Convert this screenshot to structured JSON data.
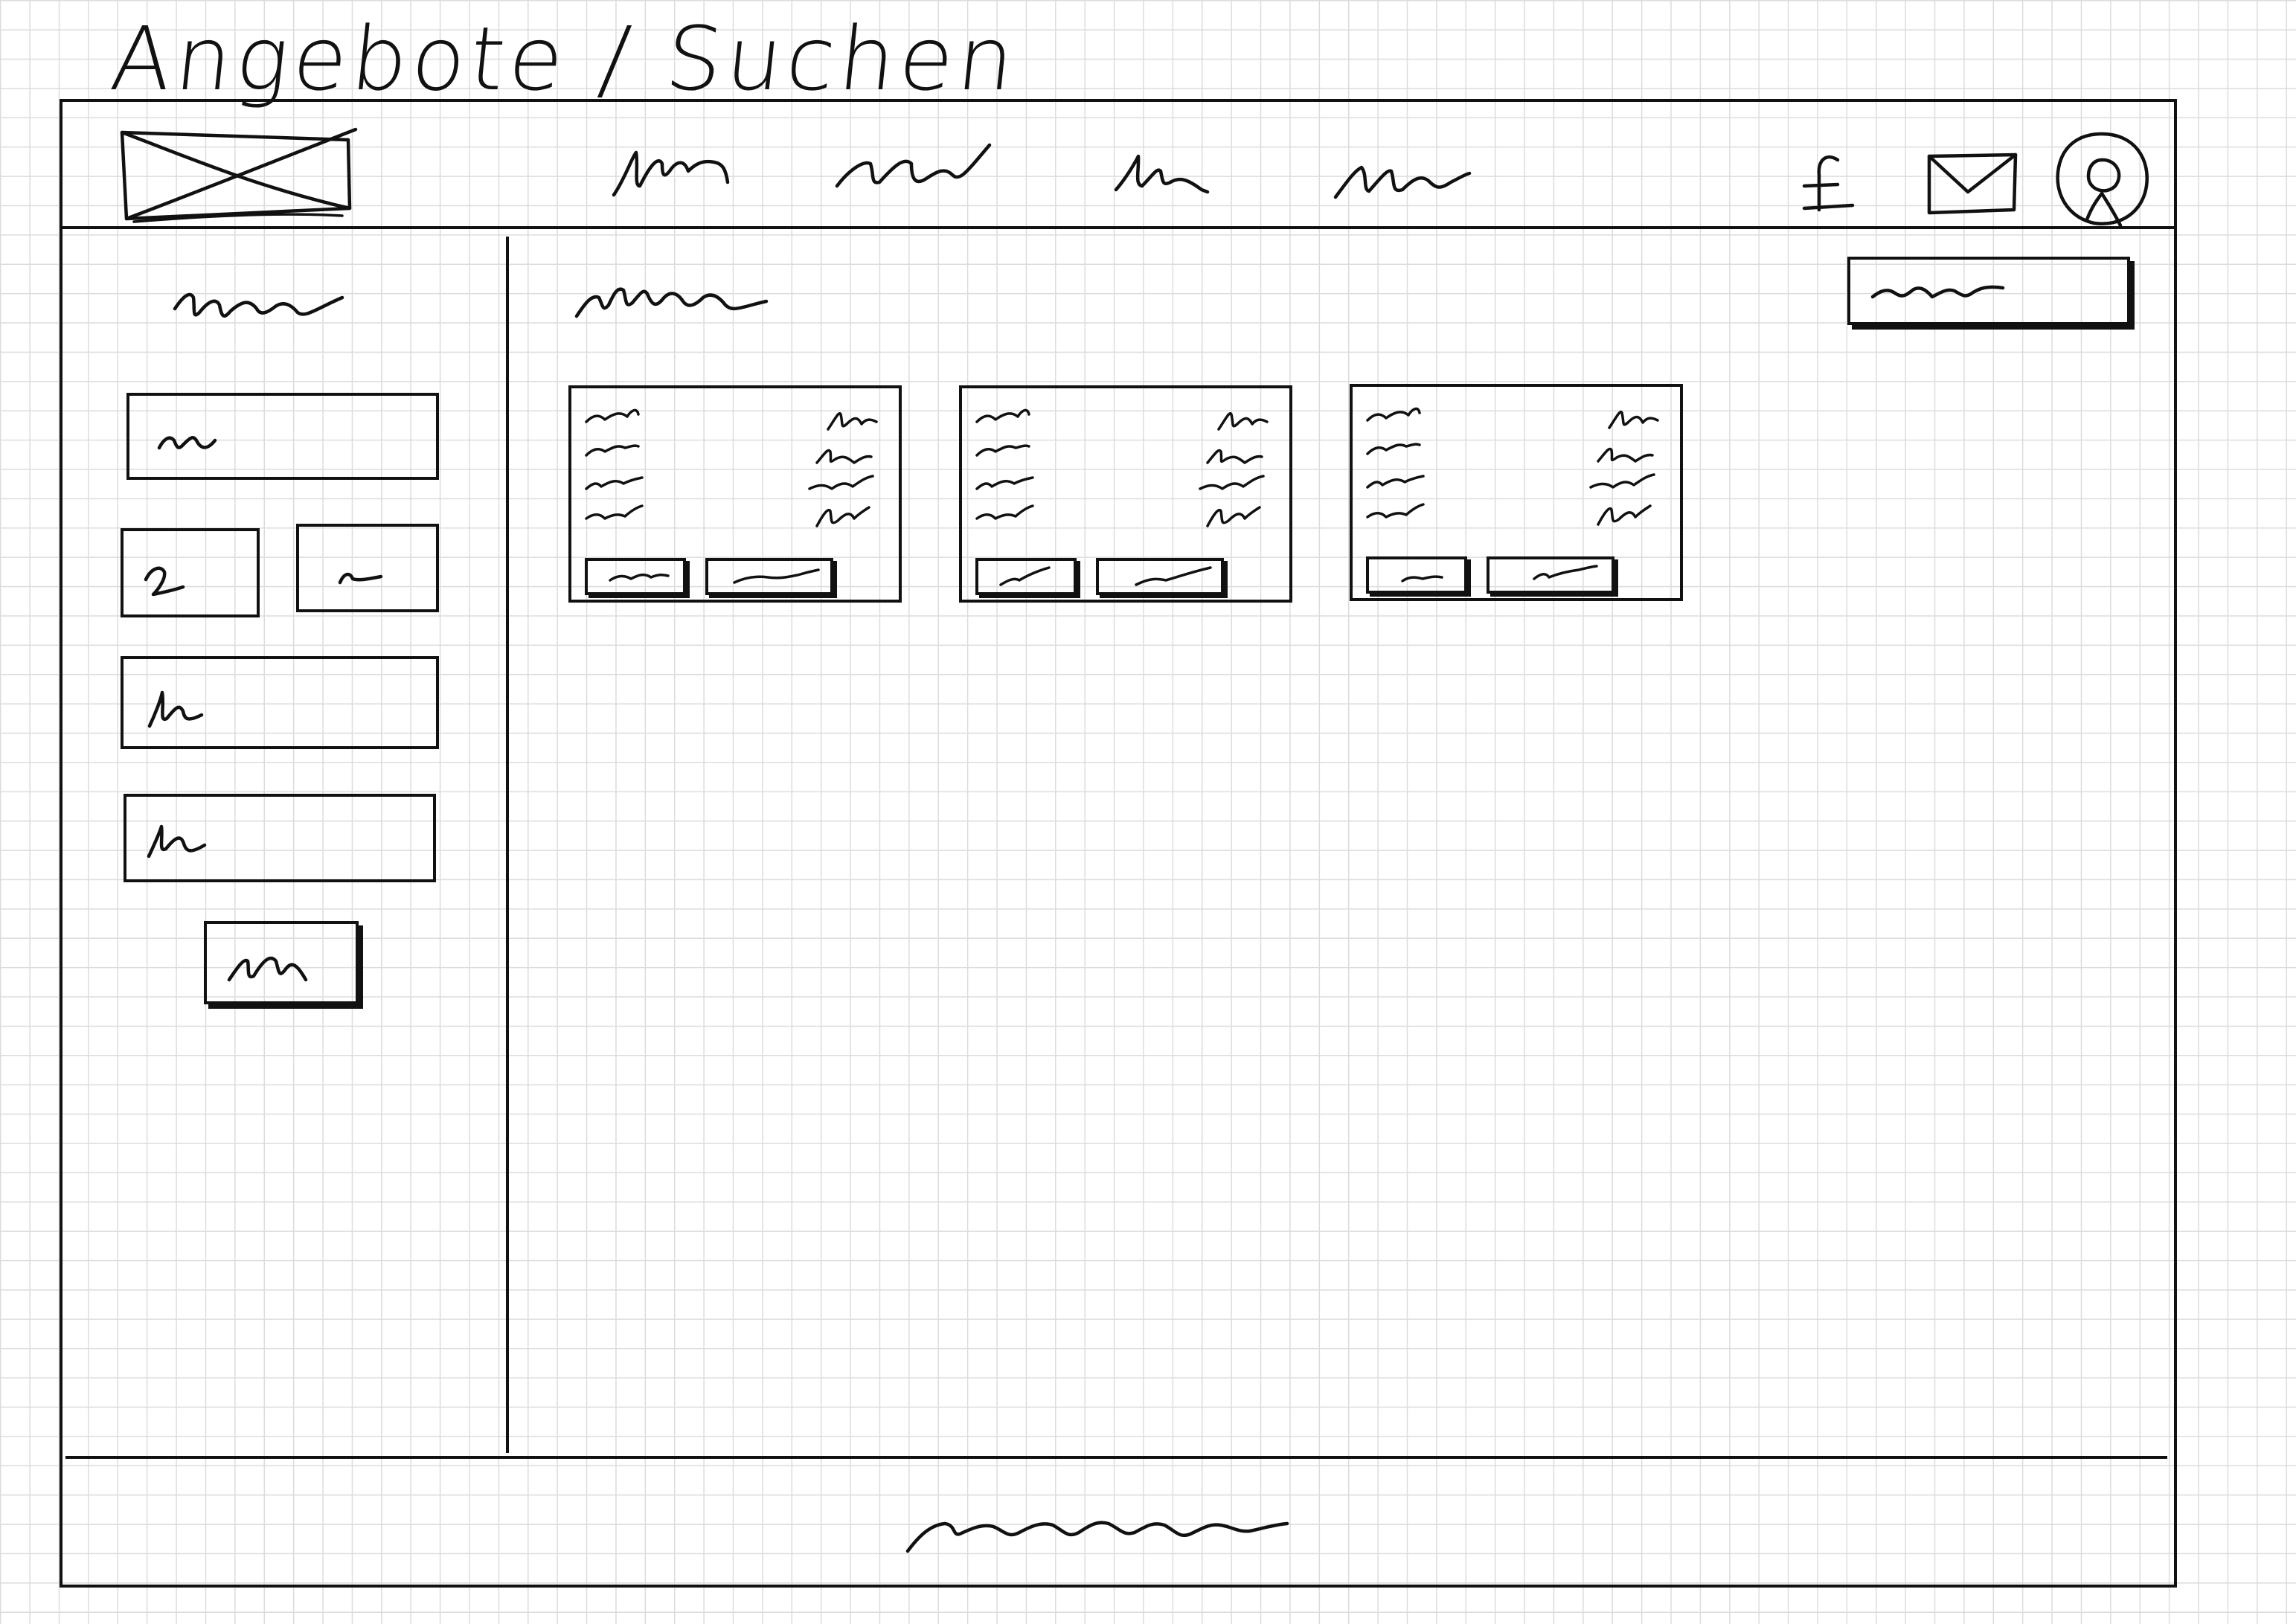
{
  "page": {
    "title": "Angebote / Suchen"
  },
  "header": {
    "logo": "image-placeholder",
    "nav_items": [
      {
        "icon": "scribble-nav-1"
      },
      {
        "icon": "scribble-nav-2"
      },
      {
        "icon": "scribble-nav-3"
      },
      {
        "icon": "scribble-nav-4"
      }
    ],
    "actions": [
      {
        "icon": "pound-icon",
        "glyph": "£"
      },
      {
        "icon": "mail-icon"
      },
      {
        "icon": "user-avatar-icon"
      }
    ]
  },
  "sidebar": {
    "heading": "scribble-heading",
    "fields": [
      "text-field",
      "small-field-left",
      "small-field-right",
      "text-field-2",
      "text-field-3"
    ],
    "submit": "submit-button"
  },
  "main": {
    "heading": "scribble-heading",
    "top_button": "action-button",
    "cards": [
      {
        "rows": 4,
        "buttons": 2
      },
      {
        "rows": 4,
        "buttons": 2
      },
      {
        "rows": 4,
        "buttons": 2
      }
    ]
  },
  "footer": {
    "text": "scribble-footer"
  },
  "colors": {
    "ink": "#111111",
    "grid": "#dcdcdc",
    "paper": "#ffffff"
  }
}
